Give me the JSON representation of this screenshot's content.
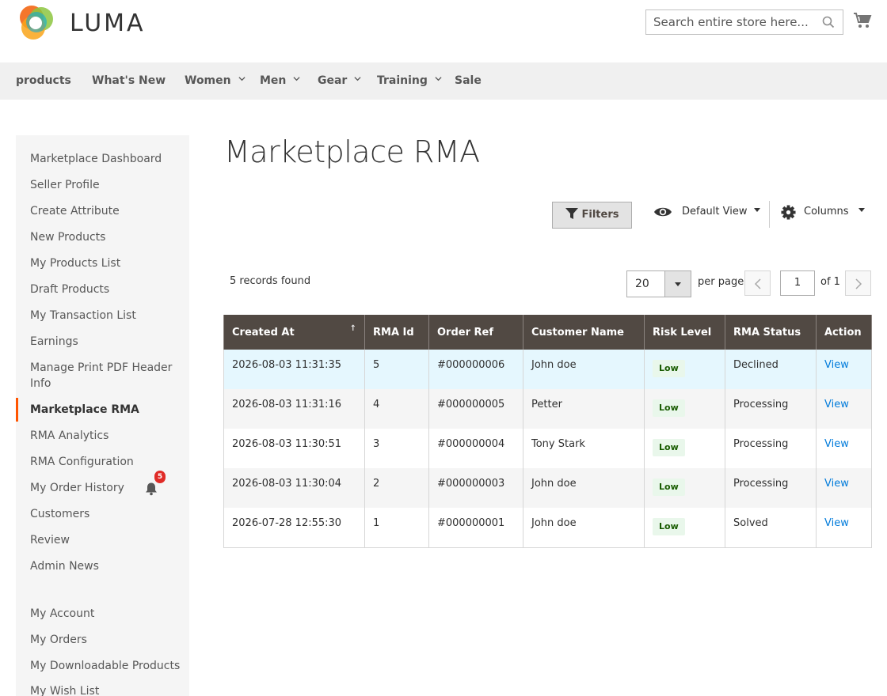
{
  "header": {
    "logo_text": "LUMA",
    "search_placeholder": "Search entire store here...",
    "search_icon": "search-icon",
    "cart_icon": "cart-icon"
  },
  "nav": {
    "items": [
      {
        "label": "products",
        "has_dropdown": false
      },
      {
        "label": "What's New",
        "has_dropdown": false
      },
      {
        "label": "Women",
        "has_dropdown": true
      },
      {
        "label": "Men",
        "has_dropdown": true
      },
      {
        "label": "Gear",
        "has_dropdown": true
      },
      {
        "label": "Training",
        "has_dropdown": true
      },
      {
        "label": "Sale",
        "has_dropdown": false
      }
    ]
  },
  "sidebar": {
    "items": [
      {
        "label": "Marketplace Dashboard"
      },
      {
        "label": "Seller Profile"
      },
      {
        "label": "Create Attribute"
      },
      {
        "label": "New Products"
      },
      {
        "label": "My Products List"
      },
      {
        "label": "Draft Products"
      },
      {
        "label": "My Transaction List"
      },
      {
        "label": "Earnings"
      },
      {
        "label": "Manage Print PDF Header Info"
      },
      {
        "label": "Marketplace RMA",
        "active": true
      },
      {
        "label": "RMA Analytics"
      },
      {
        "label": "RMA Configuration"
      },
      {
        "label": "My Order History",
        "badge": "5"
      },
      {
        "label": "Customers"
      },
      {
        "label": "Review"
      },
      {
        "label": "Admin News"
      }
    ],
    "account_items": [
      {
        "label": "My Account"
      },
      {
        "label": "My Orders"
      },
      {
        "label": "My Downloadable Products"
      },
      {
        "label": "My Wish List"
      }
    ]
  },
  "main": {
    "title": "Marketplace RMA",
    "toolbar": {
      "filters_label": "Filters",
      "view_label": "Default View",
      "columns_label": "Columns"
    },
    "records_found": "5 records found",
    "pagination": {
      "per_page_value": "20",
      "per_page_label": "per page",
      "current_page": "1",
      "of_label": "of 1"
    },
    "table": {
      "columns": [
        "Created At",
        "RMA Id",
        "Order Ref",
        "Customer Name",
        "Risk Level",
        "RMA Status",
        "Action"
      ],
      "rows": [
        {
          "created_at": "2026-08-03 11:31:35",
          "rma_id": "5",
          "order_ref": "#000000006",
          "customer": "John doe",
          "risk": "Low",
          "status": "Declined",
          "action": "View"
        },
        {
          "created_at": "2026-08-03 11:31:16",
          "rma_id": "4",
          "order_ref": "#000000005",
          "customer": "Petter",
          "risk": "Low",
          "status": "Processing",
          "action": "View"
        },
        {
          "created_at": "2026-08-03 11:30:51",
          "rma_id": "3",
          "order_ref": "#000000004",
          "customer": "Tony Stark",
          "risk": "Low",
          "status": "Processing",
          "action": "View"
        },
        {
          "created_at": "2026-08-03 11:30:04",
          "rma_id": "2",
          "order_ref": "#000000003",
          "customer": "John doe",
          "risk": "Low",
          "status": "Processing",
          "action": "View"
        },
        {
          "created_at": "2026-07-28 12:55:30",
          "rma_id": "1",
          "order_ref": "#000000001",
          "customer": "John doe",
          "risk": "Low",
          "status": "Solved",
          "action": "View"
        }
      ]
    }
  },
  "colors": {
    "accent": "#ff5501",
    "table_header": "#514943",
    "link": "#007bdb",
    "badge": "#e02b27",
    "risk_low_bg": "#e9f7eb",
    "risk_low_text": "#185b00"
  }
}
